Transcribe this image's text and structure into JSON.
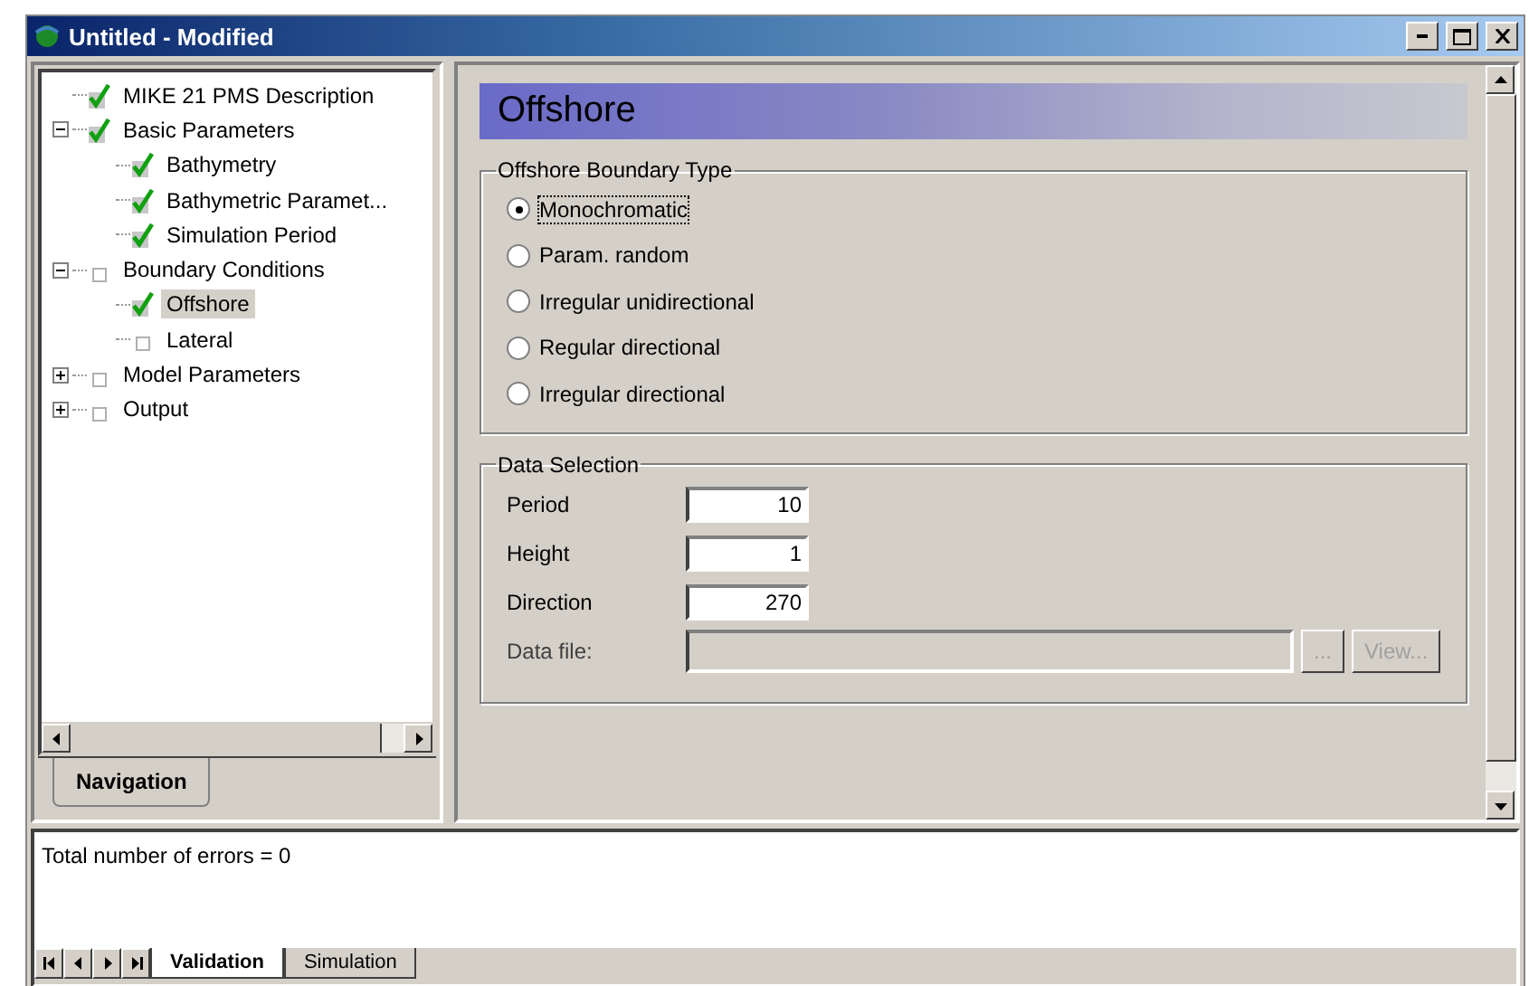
{
  "window": {
    "title": "Untitled - Modified"
  },
  "navigation": {
    "tree": [
      {
        "label": "MIKE 21 PMS Description",
        "checked": true,
        "selected": false
      },
      {
        "label": "Basic Parameters",
        "checked": true,
        "selected": false,
        "expanded": true,
        "children": [
          {
            "label": "Bathymetry",
            "checked": true,
            "selected": false
          },
          {
            "label": "Bathymetric Paramet...",
            "checked": true,
            "selected": false
          },
          {
            "label": "Simulation Period",
            "checked": true,
            "selected": false
          }
        ]
      },
      {
        "label": "Boundary Conditions",
        "checked": false,
        "selected": false,
        "expanded": true,
        "children": [
          {
            "label": "Offshore",
            "checked": true,
            "selected": true
          },
          {
            "label": "Lateral",
            "checked": false,
            "selected": false
          }
        ]
      },
      {
        "label": "Model Parameters",
        "checked": false,
        "selected": false,
        "expanded": false
      },
      {
        "label": "Output",
        "checked": false,
        "selected": false,
        "expanded": false
      }
    ],
    "tabs": [
      {
        "label": "Navigation",
        "selected": true
      }
    ]
  },
  "page": {
    "title": "Offshore",
    "boundary_type": {
      "title": "Offshore Boundary Type",
      "options": [
        {
          "label": "Monochromatic",
          "selected": true
        },
        {
          "label": "Param. random",
          "selected": false
        },
        {
          "label": "Irregular unidirectional",
          "selected": false
        },
        {
          "label": "Regular directional",
          "selected": false
        },
        {
          "label": "Irregular directional",
          "selected": false
        }
      ]
    },
    "data_selection": {
      "title": "Data Selection",
      "fields": [
        {
          "label": "Period",
          "value": "10",
          "disabled": false
        },
        {
          "label": "Height",
          "value": "1",
          "disabled": false
        },
        {
          "label": "Direction",
          "value": "270",
          "disabled": false
        }
      ],
      "data_file": {
        "label": "Data file:",
        "disabled": true,
        "buttons": [
          "...",
          "View..."
        ]
      }
    }
  },
  "output": {
    "text": "Total number of errors = 0",
    "tabs": [
      {
        "label": "Validation",
        "selected": true
      },
      {
        "label": "Simulation",
        "selected": false
      }
    ]
  }
}
